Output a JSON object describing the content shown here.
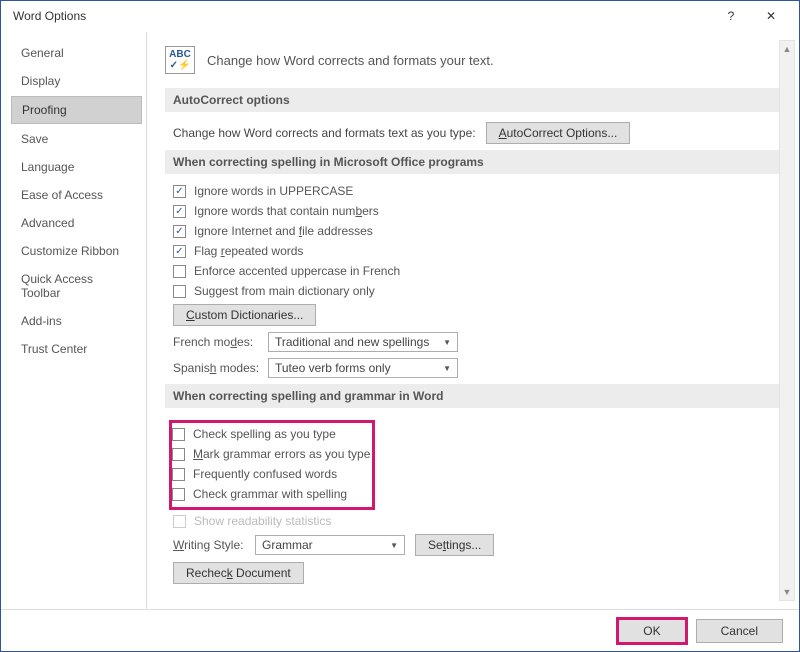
{
  "window": {
    "title": "Word Options"
  },
  "sidebar": {
    "items": [
      {
        "label": "General"
      },
      {
        "label": "Display"
      },
      {
        "label": "Proofing",
        "selected": true
      },
      {
        "label": "Save"
      },
      {
        "label": "Language"
      },
      {
        "label": "Ease of Access"
      },
      {
        "label": "Advanced"
      },
      {
        "label": "Customize Ribbon"
      },
      {
        "label": "Quick Access Toolbar"
      },
      {
        "label": "Add-ins"
      },
      {
        "label": "Trust Center"
      }
    ]
  },
  "heading": "Change how Word corrects and formats your text.",
  "sections": {
    "autocorrect": {
      "title": "AutoCorrect options",
      "desc": "Change how Word corrects and formats text as you type:",
      "button": "AutoCorrect Options..."
    },
    "spelling_office": {
      "title": "When correcting spelling in Microsoft Office programs",
      "opts": {
        "ignore_upper": "Ignore words in UPPERCASE",
        "ignore_numbers": "Ignore words that contain numbers",
        "ignore_internet": "Ignore Internet and file addresses",
        "flag_repeated": "Flag repeated words",
        "enforce_french": "Enforce accented uppercase in French",
        "suggest_main": "Suggest from main dictionary only"
      },
      "custom_dict_btn": "Custom Dictionaries...",
      "french_label": "French modes:",
      "french_value": "Traditional and new spellings",
      "spanish_label": "Spanish modes:",
      "spanish_value": "Tuteo verb forms only"
    },
    "spelling_word": {
      "title": "When correcting spelling and grammar in Word",
      "opts": {
        "check_spelling": "Check spelling as you type",
        "mark_grammar": "Mark grammar errors as you type",
        "freq_confused": "Frequently confused words",
        "check_grammar_spelling": "Check grammar with spelling",
        "readability": "Show readability statistics"
      },
      "writing_style_label": "Writing Style:",
      "writing_style_value": "Grammar",
      "settings_btn": "Settings...",
      "recheck_btn": "Recheck Document"
    }
  },
  "footer": {
    "ok": "OK",
    "cancel": "Cancel"
  }
}
